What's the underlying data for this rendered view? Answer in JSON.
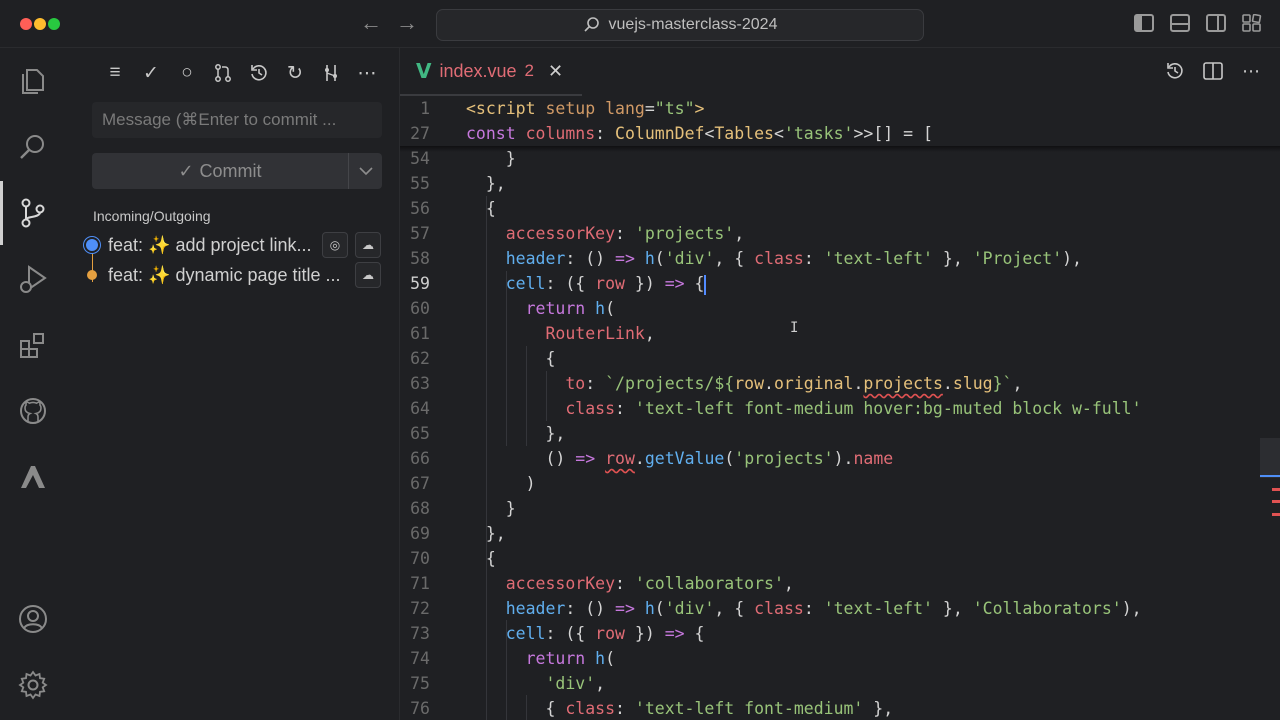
{
  "window": {
    "search_text": "vuejs-masterclass-2024"
  },
  "activity_bar": {
    "items": [
      "explorer-icon",
      "search-icon",
      "source-control-icon",
      "run-debug-icon",
      "extensions-icon",
      "github-icon",
      "remote-icon"
    ],
    "bottom": [
      "account-icon",
      "settings-gear-icon"
    ]
  },
  "source_control": {
    "commit_placeholder": "Message (⌘Enter to commit ...",
    "commit_label": "Commit",
    "commit_check": "✓",
    "section_title": "Incoming/Outgoing",
    "history": [
      {
        "label": "feat: ✨ add project link...",
        "dot_color": "#4f8ff7"
      },
      {
        "label": "feat: ✨ dynamic page title ...",
        "dot_color": "#e5a040"
      }
    ]
  },
  "editor": {
    "tab": {
      "logo": "V",
      "name": "index.vue",
      "badge": "2",
      "close": "✕"
    },
    "lines": [
      {
        "n": "1",
        "tokens": [
          [
            "tag",
            "<script"
          ],
          [
            "plain",
            " "
          ],
          [
            "attr",
            "setup"
          ],
          [
            "plain",
            " "
          ],
          [
            "attr",
            "lang"
          ],
          [
            "plain",
            "="
          ],
          [
            "str",
            "\"ts\""
          ],
          [
            "tag",
            ">"
          ]
        ]
      },
      {
        "n": "27",
        "tokens": [
          [
            "kw",
            "const"
          ],
          [
            "plain",
            " "
          ],
          [
            "prop",
            "columns"
          ],
          [
            "plain",
            ": "
          ],
          [
            "obj",
            "ColumnDef"
          ],
          [
            "plain",
            "<"
          ],
          [
            "obj",
            "Tables"
          ],
          [
            "plain",
            "<"
          ],
          [
            "str",
            "'tasks'"
          ],
          [
            "plain",
            ">>[] = ["
          ]
        ]
      },
      {
        "n": "54",
        "tokens": [
          [
            "plain",
            "    }"
          ]
        ]
      },
      {
        "n": "55",
        "tokens": [
          [
            "plain",
            "  },"
          ]
        ]
      },
      {
        "n": "56",
        "tokens": [
          [
            "plain",
            "  {"
          ]
        ]
      },
      {
        "n": "57",
        "tokens": [
          [
            "plain",
            "    "
          ],
          [
            "prop",
            "accessorKey"
          ],
          [
            "plain",
            ": "
          ],
          [
            "str",
            "'projects'"
          ],
          [
            "plain",
            ","
          ]
        ]
      },
      {
        "n": "58",
        "tokens": [
          [
            "plain",
            "    "
          ],
          [
            "fn",
            "header"
          ],
          [
            "plain",
            ": () "
          ],
          [
            "kw",
            "=>"
          ],
          [
            "plain",
            " "
          ],
          [
            "fn",
            "h"
          ],
          [
            "plain",
            "("
          ],
          [
            "str",
            "'div'"
          ],
          [
            "plain",
            ", { "
          ],
          [
            "prop",
            "class"
          ],
          [
            "plain",
            ": "
          ],
          [
            "str",
            "'text-left'"
          ],
          [
            "plain",
            " }, "
          ],
          [
            "str",
            "'Project'"
          ],
          [
            "plain",
            "),"
          ]
        ]
      },
      {
        "n": "59",
        "tokens": [
          [
            "plain",
            "    "
          ],
          [
            "fn",
            "cell"
          ],
          [
            "plain",
            ": ({ "
          ],
          [
            "prop",
            "row"
          ],
          [
            "plain",
            " }) "
          ],
          [
            "kw",
            "=>"
          ],
          [
            "plain",
            " {"
          ]
        ],
        "cursor": true
      },
      {
        "n": "60",
        "tokens": [
          [
            "plain",
            "      "
          ],
          [
            "kw",
            "return"
          ],
          [
            "plain",
            " "
          ],
          [
            "fn",
            "h"
          ],
          [
            "plain",
            "("
          ]
        ]
      },
      {
        "n": "61",
        "tokens": [
          [
            "plain",
            "        "
          ],
          [
            "prop",
            "RouterLink"
          ],
          [
            "plain",
            ","
          ]
        ]
      },
      {
        "n": "62",
        "tokens": [
          [
            "plain",
            "        {"
          ]
        ]
      },
      {
        "n": "63",
        "tokens": [
          [
            "plain",
            "          "
          ],
          [
            "prop",
            "to"
          ],
          [
            "plain",
            ": "
          ],
          [
            "str",
            "`/projects/${"
          ],
          [
            "obj",
            "row"
          ],
          [
            "plain",
            "."
          ],
          [
            "obj",
            "original"
          ],
          [
            "plain",
            "."
          ],
          [
            "obj",
            "projects",
            "err"
          ],
          [
            "plain",
            "."
          ],
          [
            "obj",
            "slug"
          ],
          [
            "str",
            "}`"
          ],
          [
            "plain",
            ","
          ]
        ]
      },
      {
        "n": "64",
        "tokens": [
          [
            "plain",
            "          "
          ],
          [
            "prop",
            "class"
          ],
          [
            "plain",
            ": "
          ],
          [
            "str",
            "'text-left font-medium hover:bg-muted block w-full'"
          ]
        ]
      },
      {
        "n": "65",
        "tokens": [
          [
            "plain",
            "        },"
          ]
        ]
      },
      {
        "n": "66",
        "tokens": [
          [
            "plain",
            "        () "
          ],
          [
            "kw",
            "=>"
          ],
          [
            "plain",
            " "
          ],
          [
            "prop",
            "row",
            "err"
          ],
          [
            "plain",
            "."
          ],
          [
            "fn",
            "getValue"
          ],
          [
            "plain",
            "("
          ],
          [
            "str",
            "'projects'"
          ],
          [
            "plain",
            ")."
          ],
          [
            "prop",
            "name"
          ]
        ]
      },
      {
        "n": "67",
        "tokens": [
          [
            "plain",
            "      )"
          ]
        ]
      },
      {
        "n": "68",
        "tokens": [
          [
            "plain",
            "    }"
          ]
        ]
      },
      {
        "n": "69",
        "tokens": [
          [
            "plain",
            "  },"
          ]
        ]
      },
      {
        "n": "70",
        "tokens": [
          [
            "plain",
            "  {"
          ]
        ]
      },
      {
        "n": "71",
        "tokens": [
          [
            "plain",
            "    "
          ],
          [
            "prop",
            "accessorKey"
          ],
          [
            "plain",
            ": "
          ],
          [
            "str",
            "'collaborators'"
          ],
          [
            "plain",
            ","
          ]
        ]
      },
      {
        "n": "72",
        "tokens": [
          [
            "plain",
            "    "
          ],
          [
            "fn",
            "header"
          ],
          [
            "plain",
            ": () "
          ],
          [
            "kw",
            "=>"
          ],
          [
            "plain",
            " "
          ],
          [
            "fn",
            "h"
          ],
          [
            "plain",
            "("
          ],
          [
            "str",
            "'div'"
          ],
          [
            "plain",
            ", { "
          ],
          [
            "prop",
            "class"
          ],
          [
            "plain",
            ": "
          ],
          [
            "str",
            "'text-left'"
          ],
          [
            "plain",
            " }, "
          ],
          [
            "str",
            "'Collaborators'"
          ],
          [
            "plain",
            "),"
          ]
        ]
      },
      {
        "n": "73",
        "tokens": [
          [
            "plain",
            "    "
          ],
          [
            "fn",
            "cell"
          ],
          [
            "plain",
            ": ({ "
          ],
          [
            "prop",
            "row"
          ],
          [
            "plain",
            " }) "
          ],
          [
            "kw",
            "=>"
          ],
          [
            "plain",
            " {"
          ]
        ]
      },
      {
        "n": "74",
        "tokens": [
          [
            "plain",
            "      "
          ],
          [
            "kw",
            "return"
          ],
          [
            "plain",
            " "
          ],
          [
            "fn",
            "h"
          ],
          [
            "plain",
            "("
          ]
        ]
      },
      {
        "n": "75",
        "tokens": [
          [
            "plain",
            "        "
          ],
          [
            "str",
            "'div'"
          ],
          [
            "plain",
            ","
          ]
        ]
      },
      {
        "n": "76",
        "tokens": [
          [
            "plain",
            "        { "
          ],
          [
            "prop",
            "class"
          ],
          [
            "plain",
            ": "
          ],
          [
            "str",
            "'text-left font-medium'"
          ],
          [
            "plain",
            " },"
          ]
        ]
      }
    ]
  }
}
